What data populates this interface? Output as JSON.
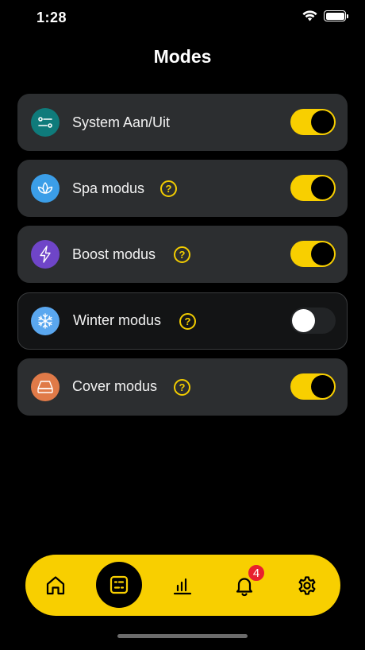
{
  "status_bar": {
    "time": "1:28"
  },
  "page": {
    "title": "Modes"
  },
  "modes": [
    {
      "label": "System Aan/Uit",
      "enabled": true,
      "has_help": false,
      "icon": "sliders-icon",
      "icon_color": "#0f7b7b"
    },
    {
      "label": "Spa modus",
      "enabled": true,
      "has_help": true,
      "icon": "lotus-icon",
      "icon_color": "#3b9ee8"
    },
    {
      "label": "Boost modus",
      "enabled": true,
      "has_help": true,
      "icon": "lightning-icon",
      "icon_color": "#6f45c8"
    },
    {
      "label": "Winter modus",
      "enabled": false,
      "has_help": true,
      "icon": "snowflake-icon",
      "icon_color": "#5aa7ef"
    },
    {
      "label": "Cover modus",
      "enabled": true,
      "has_help": true,
      "icon": "cover-icon",
      "icon_color": "#e07a48"
    }
  ],
  "help_symbol": "?",
  "nav": {
    "items": [
      "home-icon",
      "modes-icon",
      "stats-icon",
      "bell-icon",
      "gear-icon"
    ],
    "active": "modes-icon",
    "notification_count": "4"
  },
  "colors": {
    "accent": "#f8cf00",
    "card": "#2c2e30",
    "badge": "#e8202e"
  }
}
